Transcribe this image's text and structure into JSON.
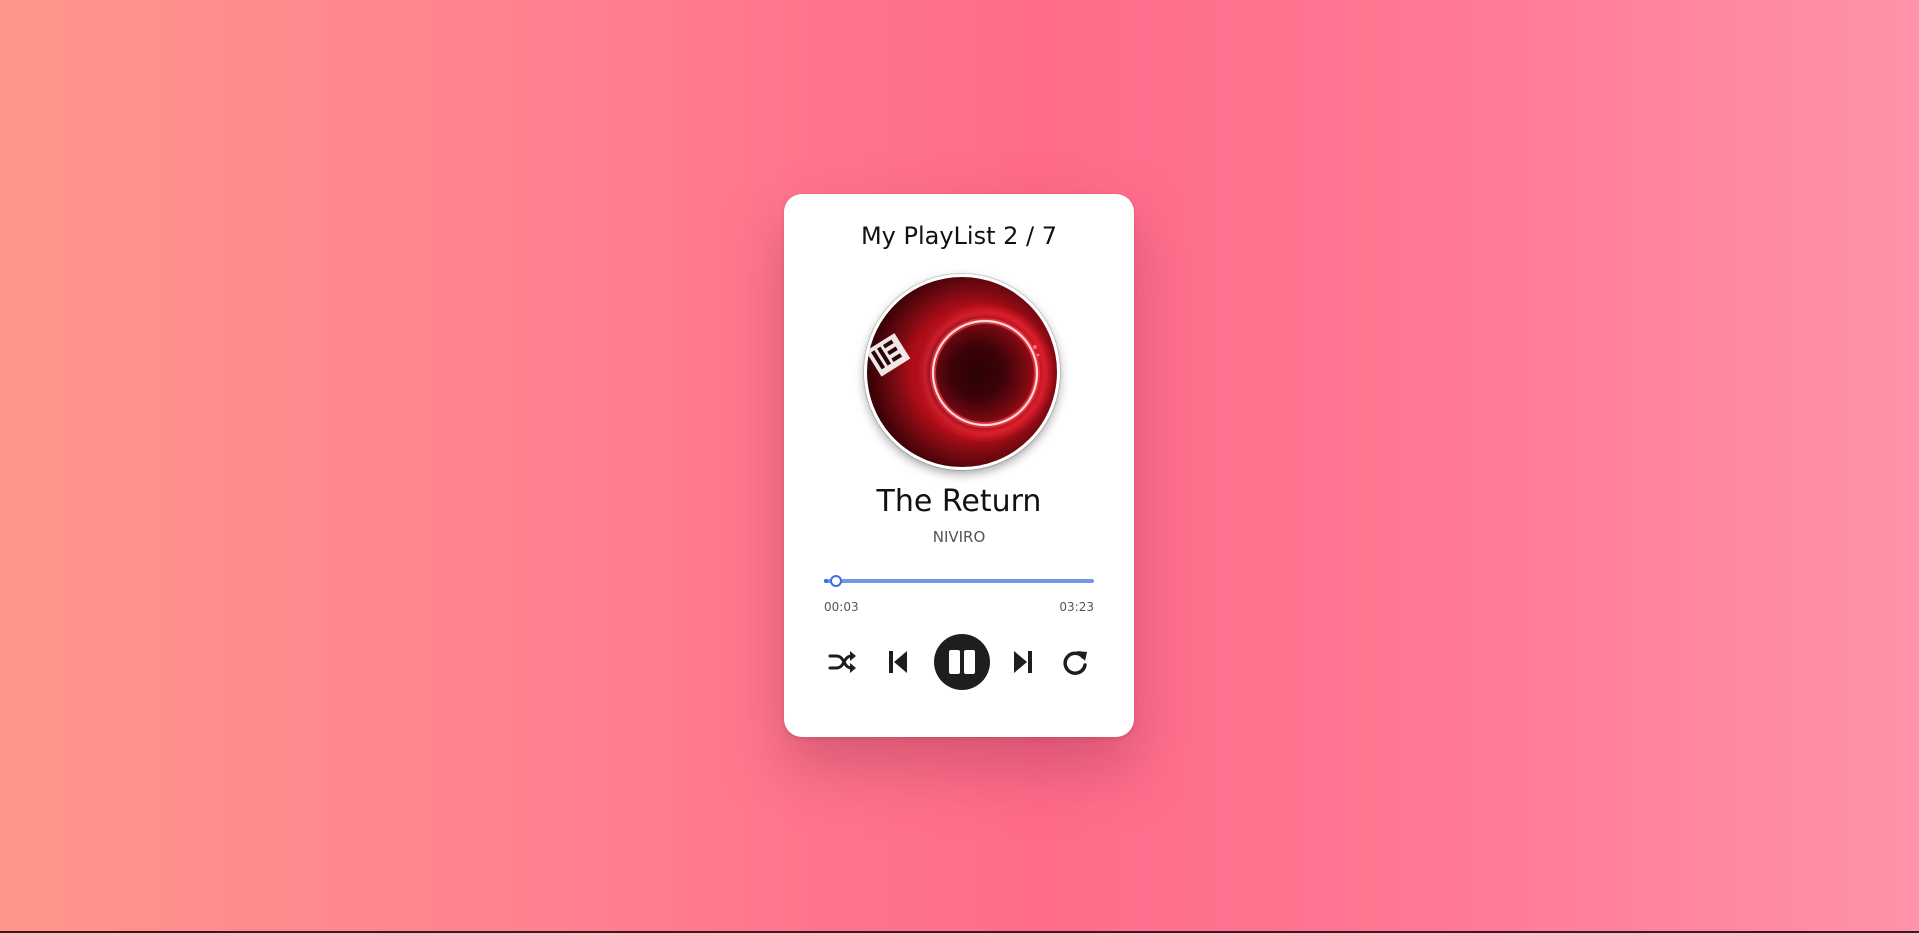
{
  "player": {
    "playlist_title": "My PlayList 2 / 7",
    "song_title": "The Return",
    "artist": "NIVIRO",
    "album_art_icon": "neon-ring-album-art",
    "progress": {
      "current_time": "00:03",
      "total_time": "03:23",
      "fraction": 0.015
    },
    "controls": [
      {
        "name": "shuffle",
        "icon": "shuffle-icon"
      },
      {
        "name": "previous",
        "icon": "skip-back-icon"
      },
      {
        "name": "play-pause",
        "icon": "pause-icon"
      },
      {
        "name": "next",
        "icon": "skip-forward-icon"
      },
      {
        "name": "repeat",
        "icon": "repeat-icon"
      }
    ]
  },
  "colors": {
    "background_left": "#ff968a",
    "background_center": "#ff6b89",
    "background_right": "#ff93a8",
    "progress_accent": "#3b6fe0",
    "progress_track": "#6f9ae8",
    "play_button": "#1e1e1e"
  }
}
